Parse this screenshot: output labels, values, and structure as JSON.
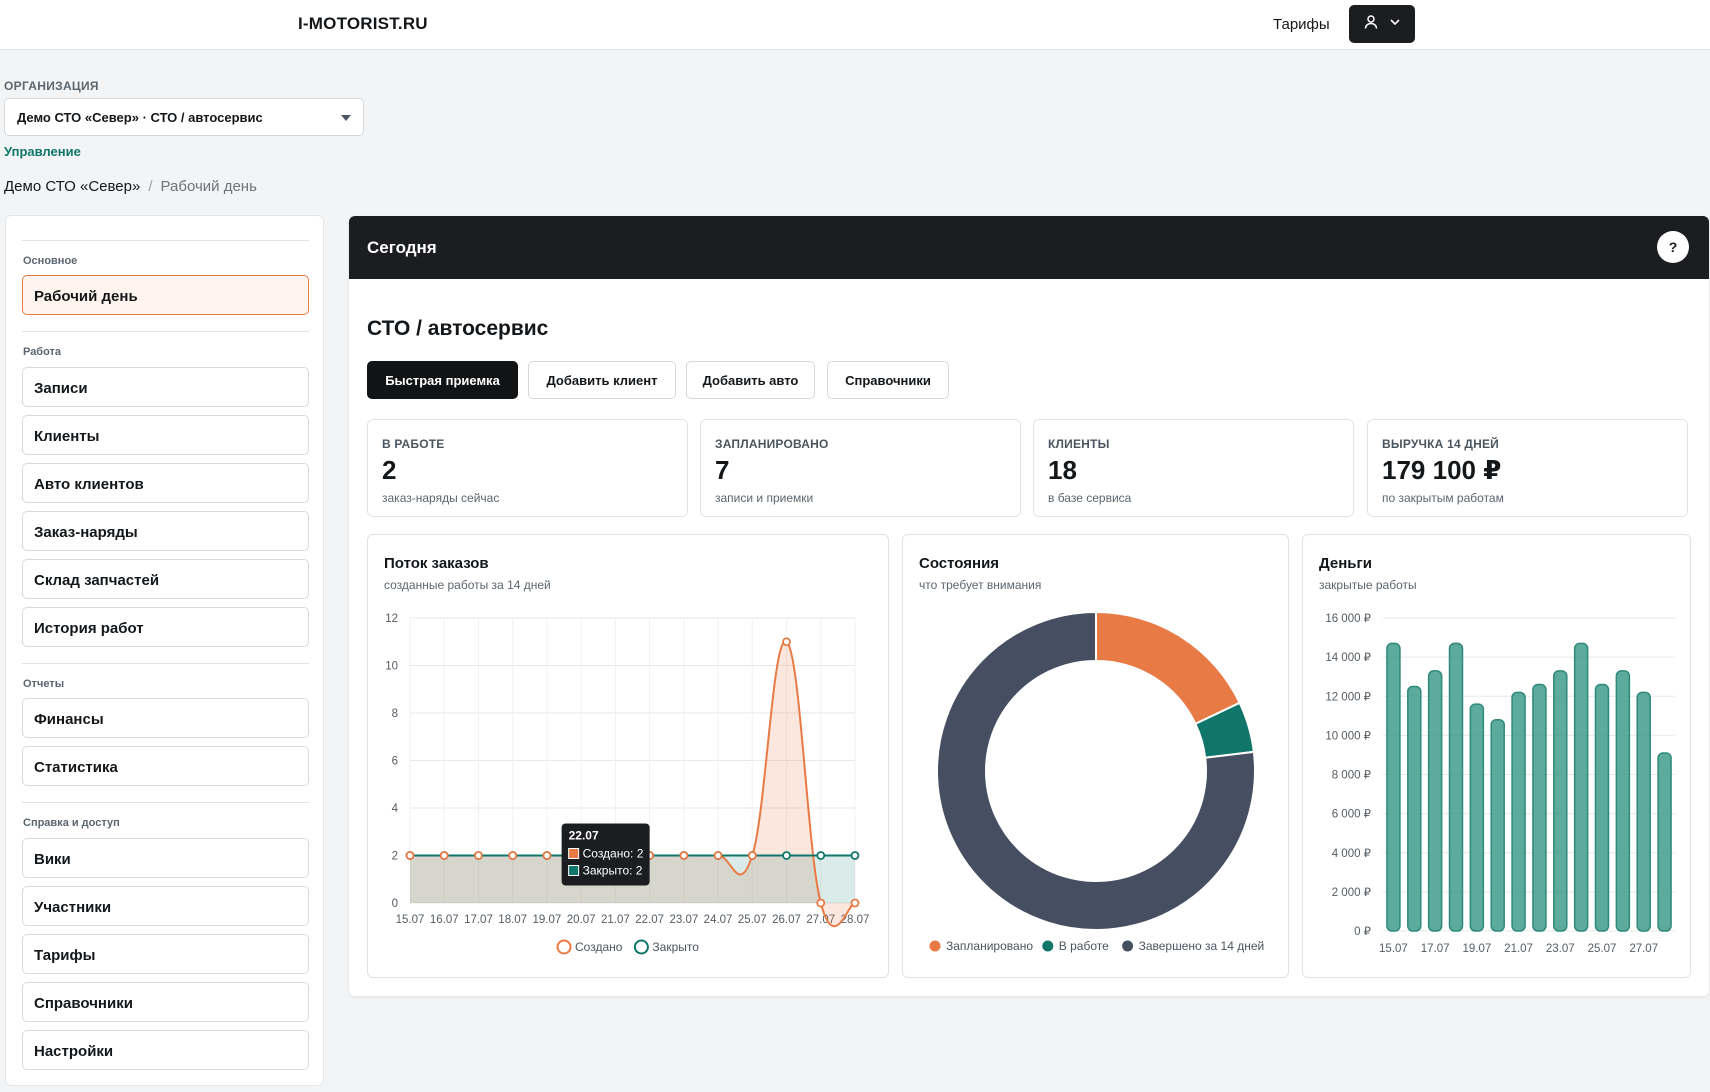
{
  "topbar": {
    "brand": "I-MOTORIST.RU",
    "tariffs_link": "Тарифы",
    "user_icon": "user-icon",
    "user_menu_icon": "chevron-down-icon"
  },
  "org": {
    "label": "ОРГАНИЗАЦИЯ",
    "selected": "Демо СТО «Север» · СТО / автосервис",
    "manage_link": "Управление"
  },
  "breadcrumb": {
    "root": "Демо СТО «Север»",
    "separator": "/",
    "current": "Рабочий день"
  },
  "sidebar": {
    "sections": [
      {
        "title": "Основное",
        "items": [
          {
            "label": "Рабочий день",
            "active": true
          }
        ]
      },
      {
        "title": "Работа",
        "items": [
          {
            "label": "Записи"
          },
          {
            "label": "Клиенты"
          },
          {
            "label": "Авто клиентов"
          },
          {
            "label": "Заказ-наряды"
          },
          {
            "label": "Склад запчастей"
          },
          {
            "label": "История работ"
          }
        ]
      },
      {
        "title": "Отчеты",
        "items": [
          {
            "label": "Финансы"
          },
          {
            "label": "Статистика"
          }
        ]
      },
      {
        "title": "Справка и доступ",
        "items": [
          {
            "label": "Вики"
          },
          {
            "label": "Участники"
          },
          {
            "label": "Тарифы"
          },
          {
            "label": "Справочники"
          },
          {
            "label": "Настройки"
          }
        ]
      }
    ]
  },
  "main": {
    "header_title": "Сегодня",
    "help_label": "?",
    "page_title": "СТО / автосервис",
    "actions": [
      "Быстрая приемка",
      "Добавить клиент",
      "Добавить авто",
      "Справочники"
    ],
    "kpis": [
      {
        "label": "В РАБОТЕ",
        "value": "2",
        "sub": "заказ-наряды сейчас"
      },
      {
        "label": "ЗАПЛАНИРОВАНО",
        "value": "7",
        "sub": "записи и приемки"
      },
      {
        "label": "КЛИЕНТЫ",
        "value": "18",
        "sub": "в базе сервиса"
      },
      {
        "label": "ВЫРУЧКА 14 ДНЕЙ",
        "value": "179 100 ₽",
        "sub": "по закрытым работам"
      }
    ]
  },
  "colors": {
    "accent_orange": "#e87a45",
    "teal": "#10766a",
    "dark_slate": "#454f61",
    "money_bar": "#3f9c8c",
    "header_bg": "#1b1d20"
  },
  "chart_data": [
    {
      "type": "line",
      "title": "Поток заказов",
      "subtitle": "созданные работы за 14 дней",
      "x": [
        "15.07",
        "16.07",
        "17.07",
        "18.07",
        "19.07",
        "20.07",
        "21.07",
        "22.07",
        "23.07",
        "24.07",
        "25.07",
        "26.07",
        "27.07",
        "28.07"
      ],
      "series": [
        {
          "name": "Создано",
          "color": "#e87a45",
          "values": [
            2,
            2,
            2,
            2,
            2,
            2,
            2,
            2,
            2,
            2,
            2,
            11,
            0,
            0
          ]
        },
        {
          "name": "Закрыто",
          "color": "#10766a",
          "values": [
            2,
            2,
            2,
            2,
            2,
            2,
            2,
            2,
            2,
            2,
            2,
            2,
            2,
            2
          ]
        }
      ],
      "ylim": [
        0,
        12
      ],
      "yticks": [
        0,
        2,
        4,
        6,
        8,
        10,
        12
      ],
      "grid": true,
      "legend": "bottom",
      "tooltip": {
        "title": "22.07",
        "lines": [
          "Создано: 2",
          "Закрыто: 2"
        ]
      }
    },
    {
      "type": "pie",
      "title": "Состояния",
      "subtitle": "что требует внимания",
      "labels": [
        "Запланировано",
        "В работе",
        "Завершено за 14 дней"
      ],
      "values": [
        7,
        2,
        30
      ],
      "colors": [
        "#e87a45",
        "#10766a",
        "#454f61"
      ],
      "legend": "bottom"
    },
    {
      "type": "bar",
      "title": "Деньги",
      "subtitle": "закрытые работы",
      "categories": [
        "15.07",
        "16.07",
        "17.07",
        "18.07",
        "19.07",
        "20.07",
        "21.07",
        "22.07",
        "23.07",
        "24.07",
        "25.07",
        "26.07",
        "27.07",
        "28.07"
      ],
      "tick_labels": [
        "15.07",
        "17.07",
        "19.07",
        "21.07",
        "23.07",
        "25.07",
        "27.07"
      ],
      "values": [
        14700,
        12500,
        13300,
        14700,
        11600,
        10800,
        12200,
        12600,
        13300,
        14700,
        12600,
        13300,
        12200,
        9100
      ],
      "color": "#3f9c8c",
      "ylim": [
        0,
        16000
      ],
      "yticks": [
        "0 ₽",
        "2 000 ₽",
        "4 000 ₽",
        "6 000 ₽",
        "8 000 ₽",
        "10 000 ₽",
        "12 000 ₽",
        "14 000 ₽",
        "16 000 ₽"
      ],
      "grid": true
    }
  ]
}
